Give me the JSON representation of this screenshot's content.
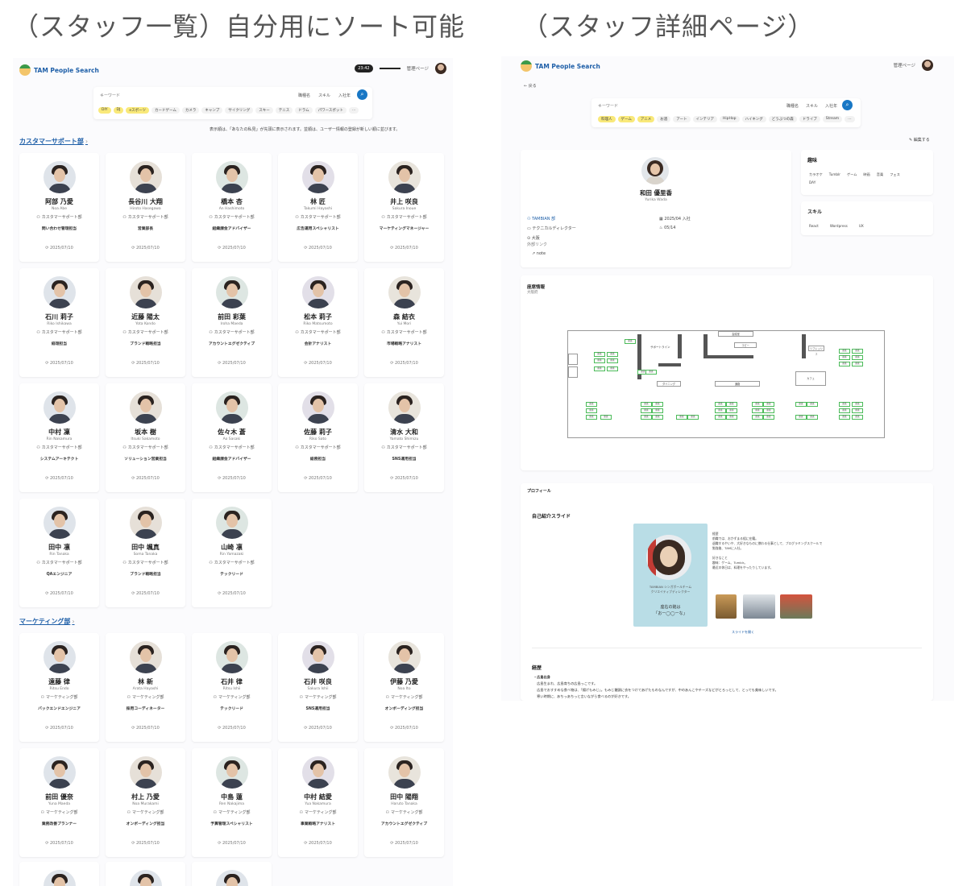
{
  "headings": {
    "left": "（スタッフ一覧）自分用にソート可能",
    "right": "（スタッフ詳細ページ）"
  },
  "app": {
    "logo": "TAM People Search",
    "admin": "管理ページ",
    "time": "23:42"
  },
  "search": {
    "placeholder": "キーワード",
    "opts": [
      "職種名",
      "スキル",
      "入社年"
    ],
    "tags": [
      "DIY",
      "DJ",
      "eスポーツ",
      "カードゲーム",
      "カメラ",
      "キャンプ",
      "サイクリング",
      "スキー",
      "テニス",
      "ドラム",
      "パワースポット",
      "…"
    ]
  },
  "notice": "表示順は、「あなたの私見」が先頭に表示されます。並順は、ユーザー情報の登録が新しい順に並びます。",
  "depts": [
    {
      "name": "カスタマーサポート部",
      "staff": [
        {
          "name": "阿部 乃愛",
          "roman": "Noa Abe",
          "dept": "カスタマーサポート部",
          "role": "問い合わせ管理担当",
          "date": "2025/07/10"
        },
        {
          "name": "長谷川 大翔",
          "roman": "Hiroto Hasegawa",
          "dept": "カスタマーサポート部",
          "role": "営業部長",
          "date": "2025/07/10"
        },
        {
          "name": "橋本 杏",
          "roman": "An Hashimoto",
          "dept": "カスタマーサポート部",
          "role": "組織課金アドバイザー",
          "date": "2025/07/10"
        },
        {
          "name": "林 匠",
          "roman": "Takumi Hayashi",
          "dept": "カスタマーサポート部",
          "role": "広告運用スペシャリスト",
          "date": "2025/07/10"
        },
        {
          "name": "井上 咲良",
          "roman": "Sakura Inoue",
          "dept": "カスタマーサポート部",
          "role": "マーケティングマネージャー",
          "date": "2025/07/10"
        },
        {
          "name": "石川 莉子",
          "roman": "Riko Ishikawa",
          "dept": "カスタマーサポート部",
          "role": "経理担当",
          "date": "2025/07/10"
        },
        {
          "name": "近藤 陽太",
          "roman": "Yota Kondo",
          "dept": "カスタマーサポート部",
          "role": "ブランド戦略担当",
          "date": "2025/07/10"
        },
        {
          "name": "前田 彩葉",
          "roman": "Iroha Maeda",
          "dept": "カスタマーサポート部",
          "role": "アカウントエグゼクティブ",
          "date": "2025/07/10"
        },
        {
          "name": "松本 莉子",
          "roman": "Riko Matsumoto",
          "dept": "カスタマーサポート部",
          "role": "会計アナリスト",
          "date": "2025/07/10"
        },
        {
          "name": "森 結衣",
          "roman": "Yui Mori",
          "dept": "カスタマーサポート部",
          "role": "市場戦略アナリスト",
          "date": "2025/07/10"
        },
        {
          "name": "中村 凜",
          "roman": "Rin Nakamura",
          "dept": "カスタマーサポート部",
          "role": "システムアーキテクト",
          "date": "2025/07/10"
        },
        {
          "name": "坂本 樹",
          "roman": "Itsuki Sakamoto",
          "dept": "カスタマーサポート部",
          "role": "ソリューション営業担当",
          "date": "2025/07/10"
        },
        {
          "name": "佐々木 蒼",
          "roman": "Ao Sasaki",
          "dept": "カスタマーサポート部",
          "role": "組織課金アドバイザー",
          "date": "2025/07/10"
        },
        {
          "name": "佐藤 莉子",
          "roman": "Riko Sato",
          "dept": "カスタマーサポート部",
          "role": "総務担当",
          "date": "2025/07/10"
        },
        {
          "name": "清水 大和",
          "roman": "Yamato Shimizu",
          "dept": "カスタマーサポート部",
          "role": "SNS運用担当",
          "date": "2025/07/10"
        },
        {
          "name": "田中 凛",
          "roman": "Rin Tanaka",
          "dept": "カスタマーサポート部",
          "role": "QAエンジニア",
          "date": "2025/07/10"
        },
        {
          "name": "田中 颯真",
          "roman": "Soma Tanaka",
          "dept": "カスタマーサポート部",
          "role": "ブランド戦略担当",
          "date": "2025/07/10"
        },
        {
          "name": "山崎 凛",
          "roman": "Rin Yamazaki",
          "dept": "カスタマーサポート部",
          "role": "テックリード",
          "date": "2025/07/10"
        }
      ]
    },
    {
      "name": "マーケティング部",
      "staff": [
        {
          "name": "遠藤 律",
          "roman": "Ritsu Endo",
          "dept": "マーケティング部",
          "role": "バックエンドエンジニア",
          "date": "2025/07/10"
        },
        {
          "name": "林 新",
          "roman": "Arata Hayashi",
          "dept": "マーケティング部",
          "role": "採用コーディネーター",
          "date": "2025/07/10"
        },
        {
          "name": "石井 律",
          "roman": "Ritsu Ishii",
          "dept": "マーケティング部",
          "role": "テックリード",
          "date": "2025/07/10"
        },
        {
          "name": "石井 咲良",
          "roman": "Sakura Ishii",
          "dept": "マーケティング部",
          "role": "SNS運用担当",
          "date": "2025/07/10"
        },
        {
          "name": "伊藤 乃愛",
          "roman": "Noa Ito",
          "dept": "マーケティング部",
          "role": "オンボーディング担当",
          "date": "2025/07/10"
        },
        {
          "name": "前田 優奈",
          "roman": "Yuna Maeda",
          "dept": "マーケティング部",
          "role": "業務改善プランナー",
          "date": "2025/07/10"
        },
        {
          "name": "村上 乃愛",
          "roman": "Noa Murakami",
          "dept": "マーケティング部",
          "role": "オンボーディング担当",
          "date": "2025/07/10"
        },
        {
          "name": "中島 蓮",
          "roman": "Ren Nakajima",
          "dept": "マーケティング部",
          "role": "予算管理スペシャリスト",
          "date": "2025/07/10"
        },
        {
          "name": "中村 結愛",
          "roman": "Yua Nakamura",
          "dept": "マーケティング部",
          "role": "事業戦略アナリスト",
          "date": "2025/07/10"
        },
        {
          "name": "田中 陽翔",
          "roman": "Haruto Tanaka",
          "dept": "マーケティング部",
          "role": "アカウントエグゼクティブ",
          "date": "2025/07/10"
        }
      ]
    }
  ],
  "detail": {
    "back": "← 戻る",
    "edit": "編集する",
    "search_tags": [
      "料理人",
      "ゲーム",
      "アニメ",
      "お酒",
      "アート",
      "インテリア",
      "HipHop",
      "ハイキング",
      "どうぶつの森",
      "ドライブ",
      "Stream",
      "…"
    ],
    "name": "和田 優里香",
    "roman": "Yurika Wada",
    "company": "TAMBIAN 部",
    "title": "テクニカルディレクター",
    "location": "大阪",
    "link_label": "外部リンク",
    "link_name": "note",
    "joined": "2025/04 入社",
    "birthday": "05/14",
    "hobby_title": "趣味",
    "hobbies": [
      "カラオケ",
      "Tumblr",
      "ゲーム",
      "映画",
      "音楽",
      "フェス",
      "DAY"
    ],
    "skill_title": "スキル",
    "skills": [
      "React",
      "Wordpress",
      "UX"
    ],
    "seat_title": "座席情報",
    "seat_sub": "大阪府",
    "floor": {
      "meeting": "会議室",
      "support": "サポートライン",
      "copy": "コピー",
      "lounge": "リフレッシュ",
      "cafe": "カフェ",
      "dining": "ダイニング",
      "aisle": "通路",
      "seat": "座席"
    },
    "profile_title": "プロフィール",
    "slide_title": "自己紹介スライド",
    "slide_caption": "TAMBIAN シンガポールチーム\nクリエイティブディレクター",
    "slide_motto": "座右の銘は\n「おー◯◯ーな」",
    "slide_text": "経歴\n前職では、おかずまる組に在籍。\n退職するやいや、大好きなものに携わる仕事として、プログラミングスクールで勉強後、TAMに入社。\n\n好きなこと\n趣味：ゲーム、Tumblr。\n最近の休日は、料理をやったりしています。",
    "slide_link": "スライドを開く",
    "career_title": "経歴",
    "career": [
      "・広島出身",
      "　広島生まれ、広島育ちの広島っこです。",
      "　広島でおすすめな食べ物は、「揚げもみじ」。もみじ饅頭に衣をつけてあげたものなんですが、中のあんこやチーズなどがとろっとして、とっても美味しいです。",
      "　寒い時期に、あちっあちっと言いながら食べるのが好きです。"
    ]
  }
}
